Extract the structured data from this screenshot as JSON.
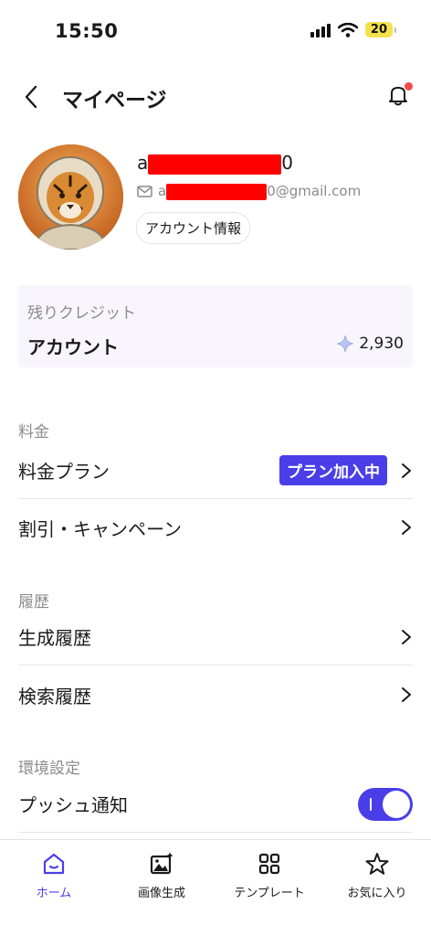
{
  "status": {
    "time": "15:50",
    "battery": "20"
  },
  "header": {
    "title": "マイページ"
  },
  "profile": {
    "username_start": "a",
    "username_end": "0",
    "email_start": "a",
    "email_end": "0@gmail.com",
    "account_info_label": "アカウント情報"
  },
  "credit": {
    "label": "残りクレジット",
    "account": "アカウント",
    "amount": "2,930"
  },
  "sections": {
    "pricing": {
      "label": "料金",
      "plan_label": "料金プラン",
      "plan_badge": "プラン加入中",
      "campaign_label": "割引・キャンペーン"
    },
    "history": {
      "label": "履歴",
      "generation_label": "生成履歴",
      "search_label": "検索履歴"
    },
    "settings": {
      "label": "環境設定",
      "push_label": "プッシュ通知",
      "push_enabled": true
    }
  },
  "nav": {
    "home": "ホーム",
    "generate": "画像生成",
    "templates": "テンプレート",
    "favorites": "お気に入り"
  },
  "colors": {
    "accent": "#4a3ee8",
    "redaction": "#ff0000",
    "notification": "#ef4b4b"
  }
}
